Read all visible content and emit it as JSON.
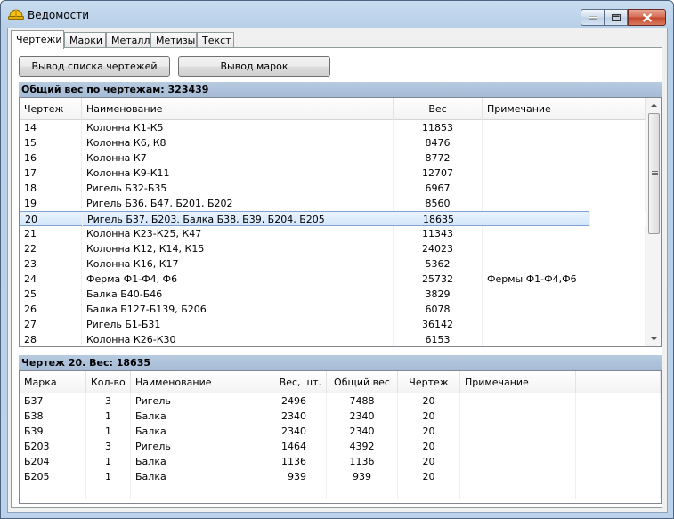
{
  "window": {
    "title": "Ведомости"
  },
  "tabs": [
    "Чертежи",
    "Марки",
    "Металл",
    "Метизы",
    "Текст"
  ],
  "toolbar": {
    "btn_drawings": "Вывод списка чертежей",
    "btn_marks": "Вывод марок"
  },
  "drawings": {
    "header": "Общий вес по чертежам: 323439",
    "columns": [
      "Чертеж",
      "Наименование",
      "Вес",
      "Примечание"
    ],
    "rows": [
      [
        "14",
        "Колонна К1-К5",
        "11853",
        ""
      ],
      [
        "15",
        "Колонна К6, К8",
        "8476",
        ""
      ],
      [
        "16",
        "Колонна К7",
        "8772",
        ""
      ],
      [
        "17",
        "Колонна К9-К11",
        "12707",
        ""
      ],
      [
        "18",
        "Ригель Б32-Б35",
        "6967",
        ""
      ],
      [
        "19",
        "Ригель Б36, Б47, Б201, Б202",
        "8560",
        ""
      ],
      [
        "20",
        "Ригель Б37, Б203. Балка Б38, Б39, Б204, Б205",
        "18635",
        ""
      ],
      [
        "21",
        "Колонна К23-К25, К47",
        "11343",
        ""
      ],
      [
        "22",
        "Колонна К12, К14, К15",
        "24023",
        ""
      ],
      [
        "23",
        "Колонна К16, К17",
        "5362",
        ""
      ],
      [
        "24",
        "Ферма Ф1-Ф4, Ф6",
        "25732",
        "Фермы Ф1-Ф4,Ф6"
      ],
      [
        "25",
        "Балка Б40-Б46",
        "3829",
        ""
      ],
      [
        "26",
        "Балка Б127-Б139, Б206",
        "6078",
        ""
      ],
      [
        "27",
        "Ригель Б1-Б31",
        "36142",
        ""
      ],
      [
        "28",
        "Колонна К26-К30",
        "6153",
        ""
      ]
    ],
    "selected_index": 6
  },
  "marks": {
    "header": "Чертеж 20. Вес: 18635",
    "columns": [
      "Марка",
      "Кол-во",
      "Наименование",
      "Вес, шт.",
      "Общий вес",
      "Чертеж",
      "Примечание"
    ],
    "rows": [
      [
        "Б37",
        "3",
        "Ригель",
        "2496",
        "7488",
        "20",
        ""
      ],
      [
        "Б38",
        "1",
        "Балка",
        "2340",
        "2340",
        "20",
        ""
      ],
      [
        "Б39",
        "1",
        "Балка",
        "2340",
        "2340",
        "20",
        ""
      ],
      [
        "Б203",
        "3",
        "Ригель",
        "1464",
        "4392",
        "20",
        ""
      ],
      [
        "Б204",
        "1",
        "Балка",
        "1136",
        "1136",
        "20",
        ""
      ],
      [
        "Б205",
        "1",
        "Балка",
        "939",
        "939",
        "20",
        ""
      ]
    ]
  },
  "colors": {
    "selection": "#d3e7fb",
    "header_band": "#a6bcd6"
  },
  "icons": {
    "app": "hardhat-icon",
    "minimize": "minimize-icon",
    "maximize": "maximize-icon",
    "close": "close-icon"
  }
}
